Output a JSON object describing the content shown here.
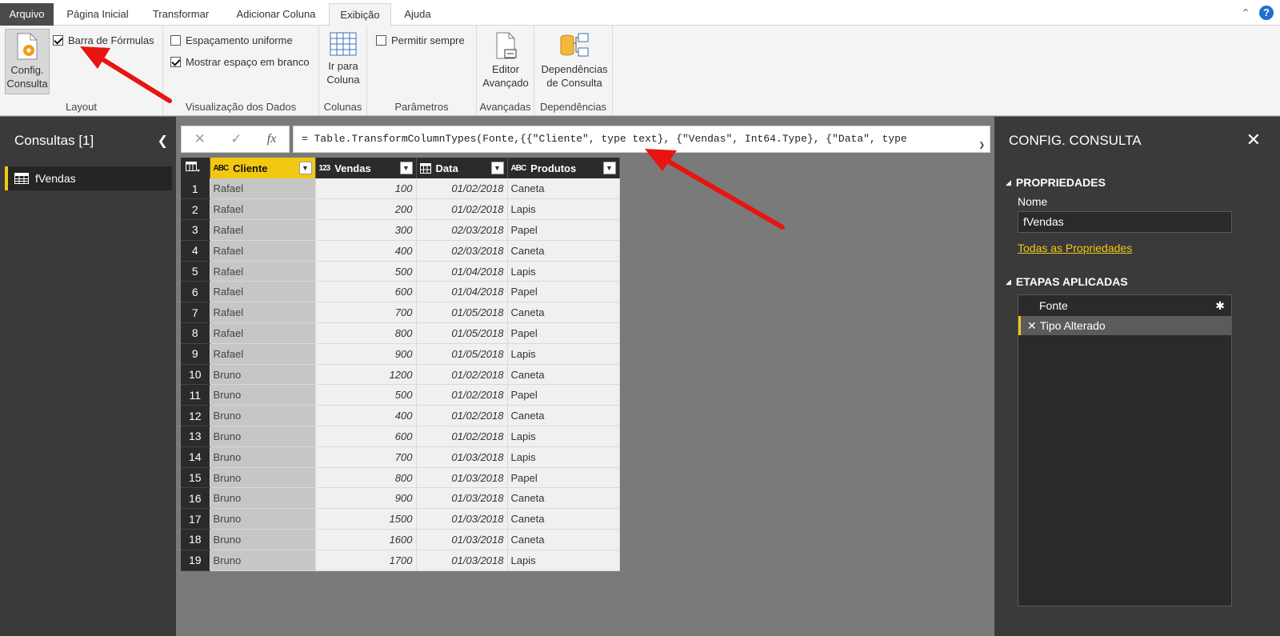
{
  "tabs": [
    "Arquivo",
    "Página Inicial",
    "Transformar",
    "Adicionar Coluna",
    "Exibição",
    "Ajuda"
  ],
  "ribbon": {
    "layout": {
      "config_label_1": "Config.",
      "config_label_2": "Consulta",
      "formula_bar_label": "Barra de Fórmulas",
      "group": "Layout"
    },
    "data_view": {
      "monospace_label": "Espaçamento uniforme",
      "whitespace_label": "Mostrar espaço em branco",
      "group": "Visualização dos Dados"
    },
    "columns": {
      "goto_1": "Ir para",
      "goto_2": "Coluna",
      "group": "Colunas"
    },
    "parameters": {
      "allow_label": "Permitir sempre",
      "group": "Parâmetros"
    },
    "advanced": {
      "editor_1": "Editor",
      "editor_2": "Avançado",
      "group": "Avançadas"
    },
    "dependencies": {
      "dep_1": "Dependências",
      "dep_2": "de Consulta",
      "group": "Dependências"
    }
  },
  "left_panel": {
    "title": "Consultas [1]",
    "query": "fVendas"
  },
  "formula_bar": {
    "fx": "fx",
    "formula": "= Table.TransformColumnTypes(Fonte,{{\"Cliente\", type text}, {\"Vendas\", Int64.Type}, {\"Data\", type"
  },
  "grid": {
    "columns": [
      {
        "type": "ABC",
        "name": "Cliente"
      },
      {
        "type": "123",
        "name": "Vendas"
      },
      {
        "type": "date",
        "name": "Data"
      },
      {
        "type": "ABC",
        "name": "Produtos"
      }
    ],
    "rows": [
      [
        "Rafael",
        "100",
        "01/02/2018",
        "Caneta"
      ],
      [
        "Rafael",
        "200",
        "01/02/2018",
        "Lapis"
      ],
      [
        "Rafael",
        "300",
        "02/03/2018",
        "Papel"
      ],
      [
        "Rafael",
        "400",
        "02/03/2018",
        "Caneta"
      ],
      [
        "Rafael",
        "500",
        "01/04/2018",
        "Lapis"
      ],
      [
        "Rafael",
        "600",
        "01/04/2018",
        "Papel"
      ],
      [
        "Rafael",
        "700",
        "01/05/2018",
        "Caneta"
      ],
      [
        "Rafael",
        "800",
        "01/05/2018",
        "Papel"
      ],
      [
        "Rafael",
        "900",
        "01/05/2018",
        "Lapis"
      ],
      [
        "Bruno",
        "1200",
        "01/02/2018",
        "Caneta"
      ],
      [
        "Bruno",
        "500",
        "01/02/2018",
        "Papel"
      ],
      [
        "Bruno",
        "400",
        "01/02/2018",
        "Caneta"
      ],
      [
        "Bruno",
        "600",
        "01/02/2018",
        "Lapis"
      ],
      [
        "Bruno",
        "700",
        "01/03/2018",
        "Lapis"
      ],
      [
        "Bruno",
        "800",
        "01/03/2018",
        "Papel"
      ],
      [
        "Bruno",
        "900",
        "01/03/2018",
        "Caneta"
      ],
      [
        "Bruno",
        "1500",
        "01/03/2018",
        "Caneta"
      ],
      [
        "Bruno",
        "1600",
        "01/03/2018",
        "Caneta"
      ],
      [
        "Bruno",
        "1700",
        "01/03/2018",
        "Lapis"
      ]
    ]
  },
  "right_panel": {
    "title": "CONFIG. CONSULTA",
    "properties_head": "PROPRIEDADES",
    "name_label": "Nome",
    "name_value": "fVendas",
    "all_props": "Todas as Propriedades",
    "steps_head": "ETAPAS APLICADAS",
    "steps": [
      "Fonte",
      "Tipo Alterado"
    ]
  },
  "colors": {
    "accent": "#f2c811",
    "arrow": "#e8140f",
    "panel_bg": "#3a3a3a",
    "canvas_bg": "#7a7a7a"
  }
}
